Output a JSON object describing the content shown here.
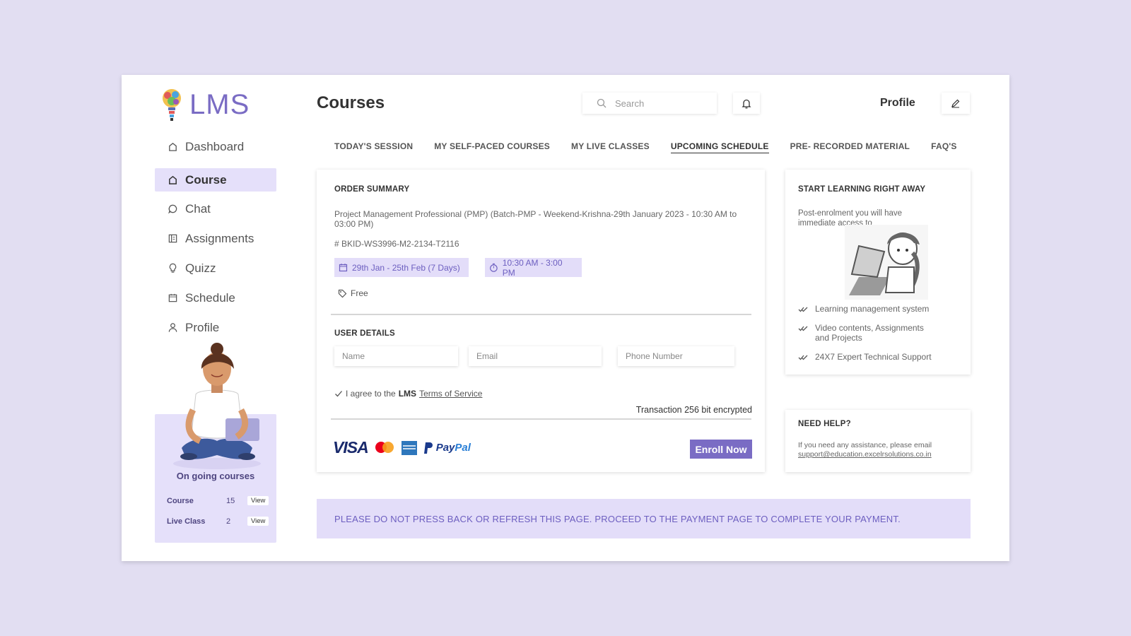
{
  "app": {
    "logo_text": "LMS"
  },
  "sidebar": {
    "items": [
      {
        "label": "Dashboard",
        "icon": "home-icon"
      },
      {
        "label": "Course",
        "icon": "home-icon",
        "active": true
      },
      {
        "label": "Chat",
        "icon": "chat-icon"
      },
      {
        "label": "Assignments",
        "icon": "assignments-icon"
      },
      {
        "label": "Quizz",
        "icon": "lightbulb-icon"
      },
      {
        "label": "Schedule",
        "icon": "calendar-icon"
      },
      {
        "label": "Profile",
        "icon": "user-icon"
      }
    ],
    "ongoing": {
      "title": "On going courses",
      "rows": [
        {
          "label": "Course",
          "count": "15",
          "action": "View"
        },
        {
          "label": "Live Class",
          "count": "2",
          "action": "View"
        }
      ]
    }
  },
  "header": {
    "title": "Courses",
    "search_placeholder": "Search",
    "profile_label": "Profile"
  },
  "tabs": [
    {
      "label": "TODAY'S SESSION"
    },
    {
      "label": "MY SELF-PACED COURSES"
    },
    {
      "label": "MY LIVE CLASSES"
    },
    {
      "label": "UPCOMING SCHEDULE",
      "active": true
    },
    {
      "label": "PRE- RECORDED MATERIAL"
    },
    {
      "label": "FAQ'S"
    }
  ],
  "order": {
    "title": "ORDER SUMMARY",
    "course_name": "Project Management Professional (PMP) (Batch-PMP - Weekend-Krishna-29th January 2023 - 10:30 AM to 03:00 PM)",
    "booking_id": "# BKID-WS3996-M2-2134-T2116",
    "dates": "29th Jan - 25th Feb (7 Days)",
    "time": "10:30 AM - 3:00 PM",
    "price": "Free"
  },
  "user_details": {
    "title": "USER DETAILS",
    "name_placeholder": "Name",
    "email_placeholder": "Email",
    "phone_placeholder": "Phone Number",
    "agree_prefix": "I agree to the",
    "agree_brand": "LMS",
    "agree_link": "Terms of Service",
    "encryption": "Transaction 256 bit encrypted"
  },
  "payment": {
    "visa": "VISA",
    "paypal_pay": "Pay",
    "paypal_pal": "Pal",
    "enroll_label": "Enroll Now"
  },
  "learn": {
    "title": "START LEARNING RIGHT AWAY",
    "intro": "Post-enrolment you will have immediate access to",
    "features": [
      "Learning management system",
      "Video contents, Assignments and Projects",
      "24X7 Expert Technical Support"
    ]
  },
  "help": {
    "title": "NEED HELP?",
    "text": "If you need any assistance, please email",
    "email": "support@education.excelrsolutions.co.in"
  },
  "notice": "PLEASE DO NOT PRESS BACK OR REFRESH THIS PAGE. PROCEED TO THE PAYMENT PAGE TO COMPLETE YOUR PAYMENT.",
  "colors": {
    "accent": "#7a6cc4",
    "accent_light": "#e3ddf9",
    "background": "#e2def2"
  }
}
